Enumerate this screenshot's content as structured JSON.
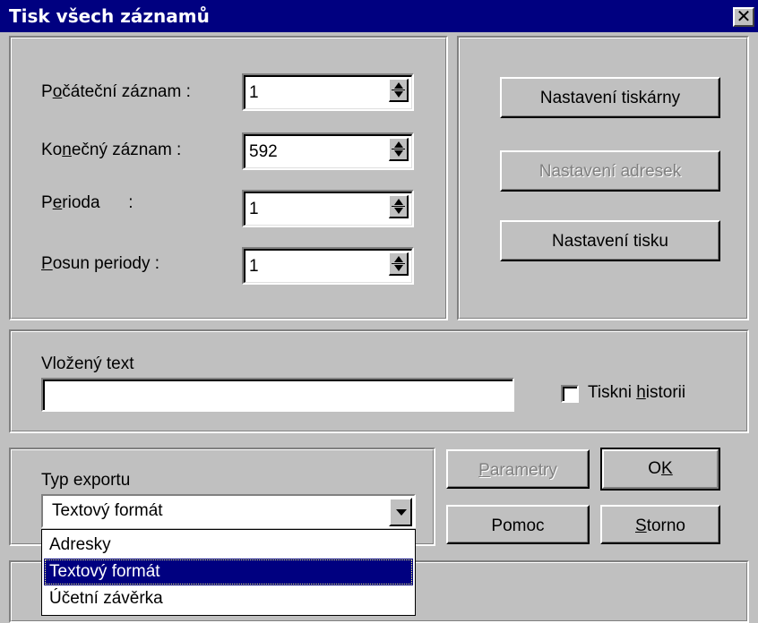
{
  "window": {
    "title": "Tisk všech záznamů",
    "close_glyph": "✕"
  },
  "range_fields": [
    {
      "label_pre": "P",
      "label_key": "o",
      "label_post": "čáteční záznam :",
      "value": "1"
    },
    {
      "label_pre": "Ko",
      "label_key": "n",
      "label_post": "ečný záznam  :",
      "value": "592"
    },
    {
      "label_pre": "P",
      "label_key": "e",
      "label_post": "rioda      :",
      "value": "1"
    },
    {
      "label_pre": "",
      "label_key": "P",
      "label_post": "osun periody :",
      "value": "1"
    }
  ],
  "side_buttons": {
    "printer_setup": "Nastavení tiskárny",
    "address_setup": "Nastavení adresek",
    "print_setup": "Nastavení tisku"
  },
  "inserted_text": {
    "label": "Vložený text",
    "value": ""
  },
  "history_checkbox": {
    "label_pre": "Tiskni ",
    "label_key": "h",
    "label_post": "istorii",
    "checked": false
  },
  "export": {
    "label": "Typ exportu",
    "selected": "Textový formát",
    "options": [
      "Adresky",
      "Textový formát",
      "Účetní závěrka"
    ],
    "highlighted_index": 1
  },
  "buttons": {
    "parameters_key": "P",
    "parameters_rest": "arametry",
    "ok_pre": "O",
    "ok_key": "K",
    "help": "Pomoc",
    "cancel_key": "S",
    "cancel_rest": "torno"
  },
  "colors": {
    "titlebar": "#000080",
    "face": "#c0c0c0",
    "selection": "#000080"
  }
}
